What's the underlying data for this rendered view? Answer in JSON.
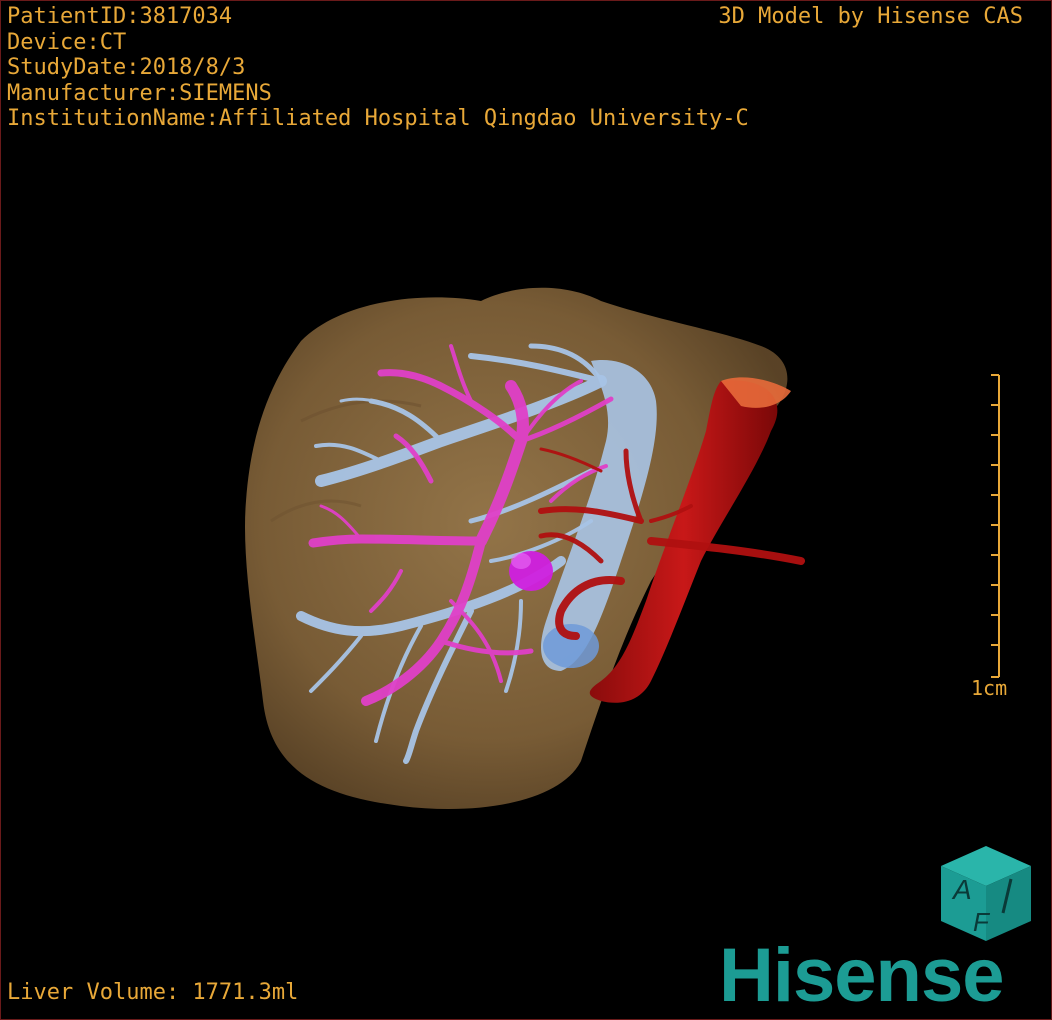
{
  "header": {
    "patient_id": "PatientID:3817034",
    "device": "Device:CT",
    "study_date": "StudyDate:2018/8/3",
    "manufacturer": "Manufacturer:SIEMENS",
    "institution": "InstitutionName:Affiliated Hospital Qingdao University-C"
  },
  "credit": "3D Model by Hisense CAS",
  "scale_bar": {
    "label": "1cm",
    "ticks": 11
  },
  "footer": {
    "liver_volume": "Liver Volume: 1771.3ml"
  },
  "logo": {
    "cube_letters": "AI F",
    "wordmark": "Hisense",
    "brand_color": "#1c9c94"
  },
  "colors": {
    "overlay_text": "#e8a838",
    "liver": "#8a6a40",
    "hepatic_vein": "#a8c4e6",
    "portal_vein": "#e040c8",
    "artery": "#b01010",
    "lesion": "#d020e0"
  }
}
